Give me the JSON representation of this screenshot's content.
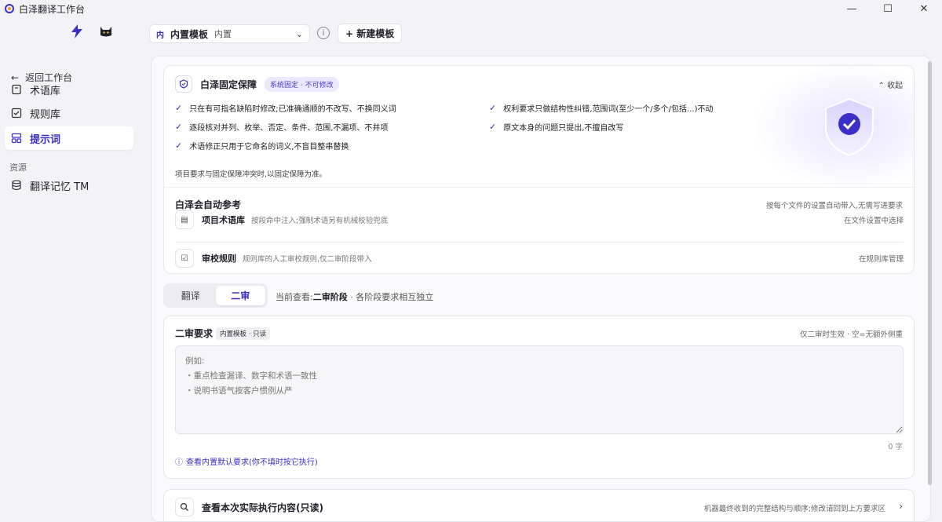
{
  "window": {
    "title": "白泽翻译工作台",
    "minimize": "—",
    "maximize": "☐",
    "close": "✕"
  },
  "sidebar": {
    "back_label": "返回工作台",
    "items": [
      {
        "label": "术语库",
        "icon": "book-icon"
      },
      {
        "label": "规则库",
        "icon": "checklist-icon"
      },
      {
        "label": "提示词",
        "icon": "layout-icon",
        "active": true
      }
    ],
    "section_label": "资源",
    "resources": [
      {
        "label": "翻译记忆 TM",
        "icon": "database-icon"
      }
    ]
  },
  "toolbar": {
    "template_badge": "内",
    "template_name": "内置模板",
    "template_sub": "内置",
    "new_button": "+ 新建模板"
  },
  "guard": {
    "title": "白泽固定保障",
    "badge": "系统固定 · 不可修改",
    "collapse_label": "收起",
    "rules_left": [
      "只在有可指名缺陷时修改;已准确通顺的不改写、不换同义词",
      "逐段核对并列、枚举、否定、条件、范围,不漏项、不并项",
      "术语修正只用于它命名的词义,不盲目整串替换"
    ],
    "rules_right": [
      "权利要求只做结构性纠错,范围词(至少一个/多个/包括...)不动",
      "原文本身的问题只提出,不擅自改写"
    ],
    "note": "项目要求与固定保障冲突时,以固定保障为准。",
    "check_mark": "✓"
  },
  "auto_ref": {
    "title": "白泽会自动参考",
    "hint": "按每个文件的设置自动带入,无需写进要求",
    "rows": [
      {
        "name": "项目术语库",
        "desc": "按段命中注入;强制术语另有机械校验兜底",
        "right": "在文件设置中选择"
      },
      {
        "name": "审校规则",
        "desc": "规则库的人工审校规则,仅二审阶段带入",
        "right": "在规则库管理"
      }
    ]
  },
  "stage": {
    "tabs": [
      "翻译",
      "二审"
    ],
    "active_index": 1,
    "info_prefix": "当前查看:",
    "info_stage": "二审阶段",
    "info_suffix": " · 各阶段要求相互独立"
  },
  "requirement": {
    "title": "二审要求",
    "badge": "内置模板 · 只读",
    "hint": "仅二审时生效 · 空=无额外侧重",
    "placeholder": "例如:\n・重点检查漏译、数字和术语一致性\n・说明书语气按客户惯例从严",
    "count": "0 字",
    "link": "查看内置默认要求(你不填时按它执行)"
  },
  "execution": {
    "title": "查看本次实际执行内容(只读)",
    "hint": "机器最终收到的完整结构与顺序;修改请回到上方要求区"
  }
}
